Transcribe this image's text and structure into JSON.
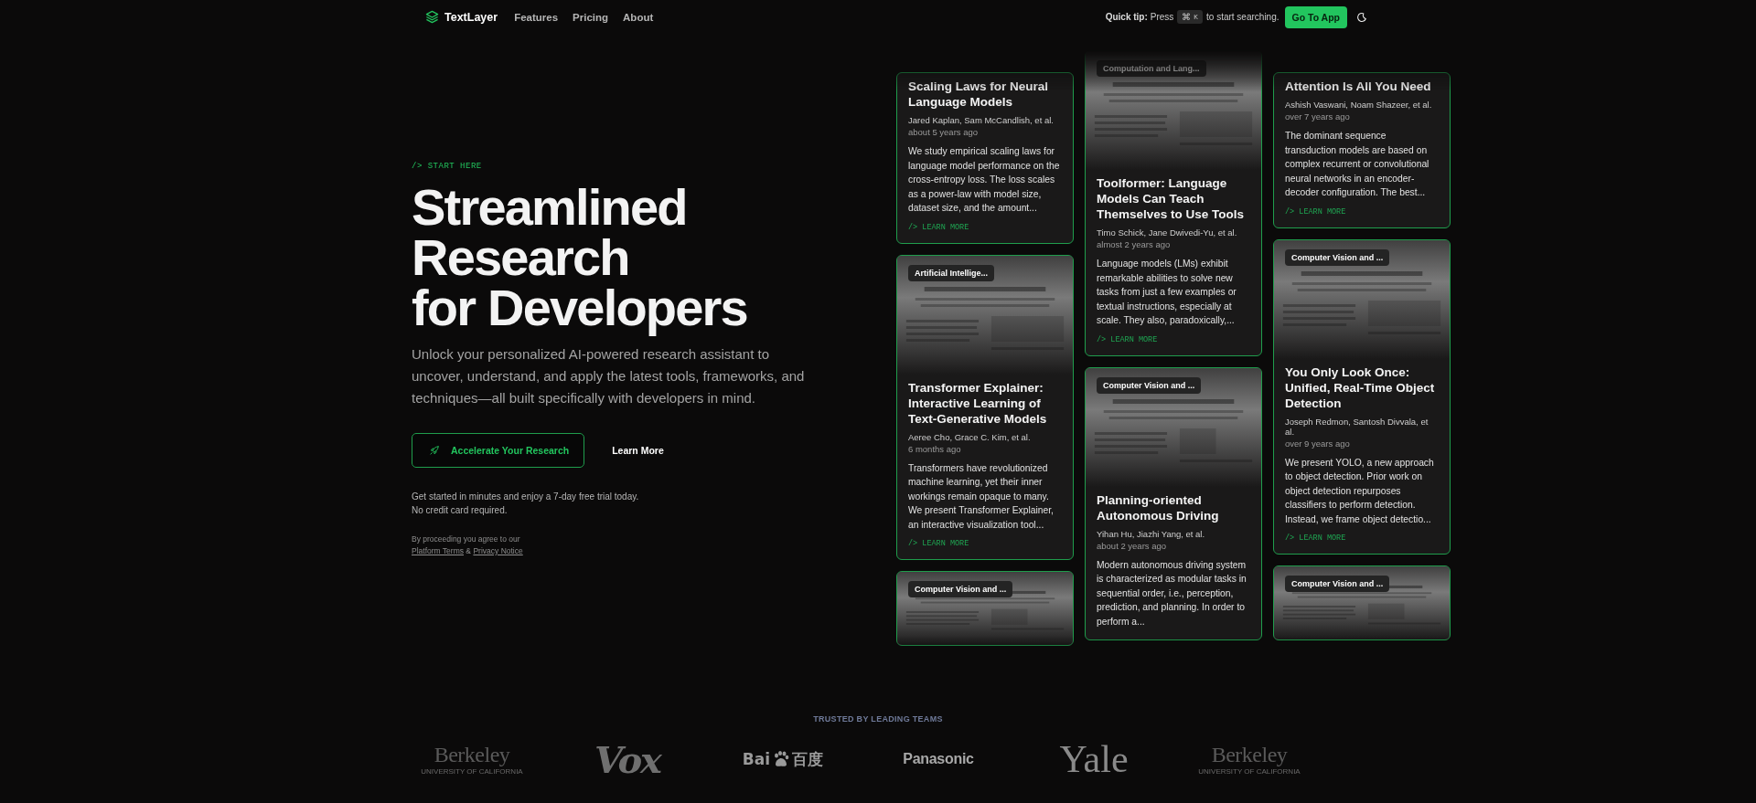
{
  "nav": {
    "brand": "TextLayer",
    "links": [
      "Features",
      "Pricing",
      "About"
    ],
    "tip": {
      "label": "Quick tip:",
      "before": "Press",
      "keys": [
        "⌘",
        "K"
      ],
      "after": "to start searching."
    },
    "cta": "Go To App"
  },
  "hero": {
    "eyebrow": "/> START HERE",
    "title_lines": [
      "Streamlined",
      "Research",
      "for Developers"
    ],
    "subtitle": "Unlock your personalized AI-powered research assistant to uncover, understand, and apply the latest tools, frameworks, and techniques—all built specifically with developers in mind.",
    "primary_button": "Accelerate Your Research",
    "secondary_button": "Learn More",
    "trial_note": [
      "Get started in minutes and enjoy a 7-day free trial today.",
      "No credit card required."
    ],
    "legal": {
      "text": "By proceeding you agree to our",
      "links": [
        "Platform Terms",
        "Privacy Notice"
      ],
      "joiner": "&"
    }
  },
  "papers": [
    [
      {
        "preview": false,
        "title": "Scaling Laws for Neural Language Models",
        "authors": "Jared Kaplan, Sam McCandlish, et al.",
        "date": "about 5 years ago",
        "abstract": "We study empirical scaling laws for language model performance on the cross-entropy loss. The loss scales as a power-law with model size, dataset size, and the amount...",
        "link": "/> LEARN MORE"
      },
      {
        "category": "Artificial Intellige...",
        "preview": true,
        "title": "Transformer Explainer: Interactive Learning of Text-Generative Models",
        "authors": "Aeree Cho, Grace C. Kim, et al.",
        "date": "6 months ago",
        "abstract": "Transformers have revolutionized machine learning, yet their inner workings remain opaque to many. We present Transformer Explainer, an interactive visualization tool...",
        "link": "/> LEARN MORE"
      },
      {
        "category": "Computer Vision and ...",
        "preview": true
      }
    ],
    [
      {
        "category": "Computation and Lang...",
        "preview": true,
        "title": "Toolformer: Language Models Can Teach Themselves to Use Tools",
        "authors": "Timo Schick, Jane Dwivedi-Yu, et al.",
        "date": "almost 2 years ago",
        "abstract": "Language models (LMs) exhibit remarkable abilities to solve new tasks from just a few examples or textual instructions, especially at scale. They also, paradoxically,...",
        "link": "/> LEARN MORE"
      },
      {
        "category": "Computer Vision and ...",
        "preview": true,
        "title": "Planning-oriented Autonomous Driving",
        "authors": "Yihan Hu, Jiazhi Yang, et al.",
        "date": "about 2 years ago",
        "abstract": "Modern autonomous driving system is characterized as modular tasks in sequential order, i.e., perception, prediction, and planning. In order to perform a..."
      }
    ],
    [
      {
        "preview": false,
        "title": "Attention Is All You Need",
        "authors": "Ashish Vaswani, Noam Shazeer, et al.",
        "date": "over 7 years ago",
        "abstract": "The dominant sequence transduction models are based on complex recurrent or convolutional neural networks in an encoder-decoder configuration. The best...",
        "link": "/> LEARN MORE"
      },
      {
        "category": "Computer Vision and ...",
        "preview": true,
        "title": "You Only Look Once: Unified, Real-Time Object Detection",
        "authors": "Joseph Redmon, Santosh Divvala, et al.",
        "date": "over 9 years ago",
        "abstract": "We present YOLO, a new approach to object detection. Prior work on object detection repurposes classifiers to perform detection. Instead, we frame object detectio...",
        "link": "/> LEARN MORE"
      },
      {
        "category": "Computer Vision and ...",
        "preview": true
      }
    ]
  ],
  "trusted": {
    "heading": "TRUSTED BY LEADING TEAMS",
    "logos": [
      {
        "kind": "serif",
        "name": "Berkeley",
        "subtitle": "UNIVERSITY OF CALIFORNIA",
        "dim": true
      },
      {
        "kind": "slab",
        "name": "Vox",
        "dim": false
      },
      {
        "kind": "baidu",
        "before": "Bai",
        "after": "百度",
        "dim": false
      },
      {
        "kind": "sans",
        "name": "Panasonic",
        "dim": false
      },
      {
        "kind": "serif-large",
        "name": "Yale",
        "dim": false
      },
      {
        "kind": "serif",
        "name": "Berkeley",
        "subtitle": "UNIVERSITY OF CALIFORNIA",
        "dim": true
      }
    ]
  }
}
